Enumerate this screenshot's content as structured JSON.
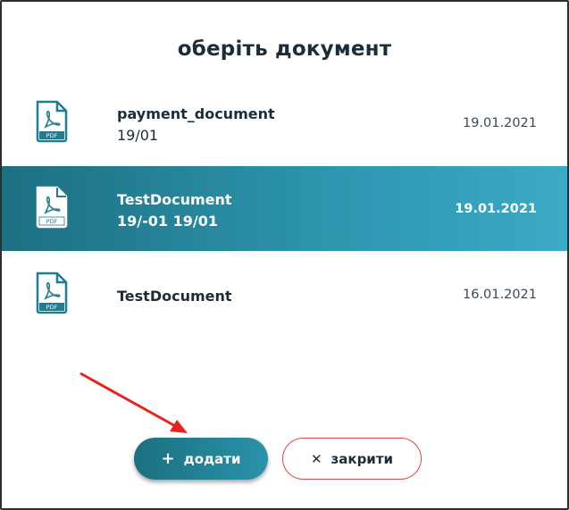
{
  "dialog": {
    "title": "оберіть документ"
  },
  "documents": [
    {
      "name": "payment_document",
      "subtitle": "19/01",
      "date": "19.01.2021",
      "icon": "pdf-file-icon",
      "selected": false
    },
    {
      "name": "TestDocument",
      "subtitle": "19/-01 19/01",
      "date": "19.01.2021",
      "icon": "pdf-file-icon",
      "selected": true
    },
    {
      "name": "TestDocument",
      "subtitle": "",
      "date": "16.01.2021",
      "icon": "pdf-file-icon",
      "selected": false
    }
  ],
  "pdf_icon_label": "PDF",
  "actions": {
    "add_icon": "+",
    "add_label": "додати",
    "close_icon": "✕",
    "close_label": "закрити"
  },
  "colors": {
    "accent": "#2a8ea6",
    "selected_start": "#1d6f81",
    "selected_end": "#3caac6",
    "close_border": "#e04848",
    "annotation_arrow": "#e8231c"
  }
}
